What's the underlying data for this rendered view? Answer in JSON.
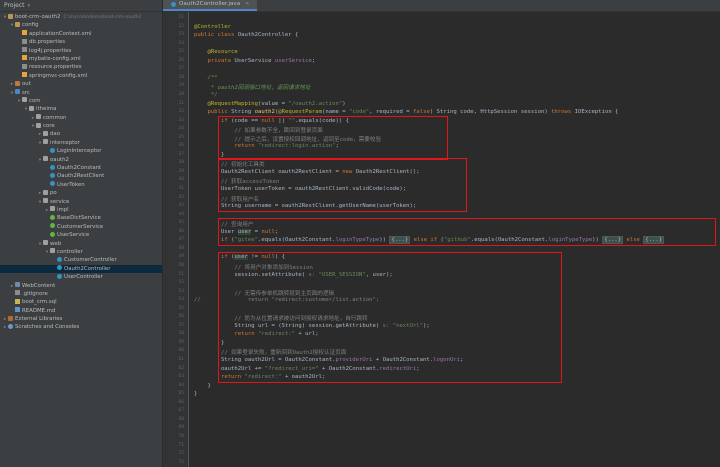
{
  "project_panel": {
    "title": "Project",
    "items": [
      {
        "label": "boot-crm-oauth2",
        "path": "C:\\mycode\\demo\\boot-crm-oauth2",
        "depth": 0,
        "arrow": "▾",
        "icon": "folder"
      },
      {
        "label": "config",
        "depth": 1,
        "arrow": "▾",
        "icon": "folder"
      },
      {
        "label": "applicationContext.xml",
        "depth": 2,
        "arrow": "",
        "icon": "file-xml"
      },
      {
        "label": "db.properties",
        "depth": 2,
        "arrow": "",
        "icon": "file-prop"
      },
      {
        "label": "log4j.properties",
        "depth": 2,
        "arrow": "",
        "icon": "file-prop"
      },
      {
        "label": "mybatis-config.xml",
        "depth": 2,
        "arrow": "",
        "icon": "file-xml"
      },
      {
        "label": "resource.properties",
        "depth": 2,
        "arrow": "",
        "icon": "file-prop"
      },
      {
        "label": "springmvc-config.xml",
        "depth": 2,
        "arrow": "",
        "icon": "file-xml"
      },
      {
        "label": "out",
        "depth": 1,
        "arrow": "▸",
        "icon": "folder-target"
      },
      {
        "label": "src",
        "depth": 1,
        "arrow": "▾",
        "icon": "folder-src"
      },
      {
        "label": "com",
        "depth": 2,
        "arrow": "▾",
        "icon": "pkg"
      },
      {
        "label": "itheima",
        "depth": 3,
        "arrow": "▾",
        "icon": "pkg"
      },
      {
        "label": "common",
        "depth": 4,
        "arrow": "▸",
        "icon": "pkg"
      },
      {
        "label": "core",
        "depth": 4,
        "arrow": "▾",
        "icon": "pkg"
      },
      {
        "label": "dao",
        "depth": 5,
        "arrow": "▸",
        "icon": "pkg"
      },
      {
        "label": "interceptor",
        "depth": 5,
        "arrow": "▾",
        "icon": "pkg"
      },
      {
        "label": "LoginInterceptor",
        "depth": 6,
        "arrow": "",
        "icon": "class"
      },
      {
        "label": "oauth2",
        "depth": 5,
        "arrow": "▾",
        "icon": "pkg"
      },
      {
        "label": "Oauth2Constant",
        "depth": 6,
        "arrow": "",
        "icon": "class"
      },
      {
        "label": "Oauth2RestClient",
        "depth": 6,
        "arrow": "",
        "icon": "class"
      },
      {
        "label": "UserToken",
        "depth": 6,
        "arrow": "",
        "icon": "class"
      },
      {
        "label": "po",
        "depth": 5,
        "arrow": "▸",
        "icon": "pkg"
      },
      {
        "label": "service",
        "depth": 5,
        "arrow": "▾",
        "icon": "pkg"
      },
      {
        "label": "impl",
        "depth": 6,
        "arrow": "▸",
        "icon": "pkg"
      },
      {
        "label": "BaseDictService",
        "depth": 6,
        "arrow": "",
        "icon": "iface"
      },
      {
        "label": "CustomerService",
        "depth": 6,
        "arrow": "",
        "icon": "iface"
      },
      {
        "label": "UserService",
        "depth": 6,
        "arrow": "",
        "icon": "iface"
      },
      {
        "label": "web",
        "depth": 5,
        "arrow": "▾",
        "icon": "pkg"
      },
      {
        "label": "controller",
        "depth": 6,
        "arrow": "▾",
        "icon": "pkg"
      },
      {
        "label": "CustomerController",
        "depth": 7,
        "arrow": "",
        "icon": "class"
      },
      {
        "label": "Oauth2Controller",
        "depth": 7,
        "arrow": "",
        "icon": "class",
        "selected": true
      },
      {
        "label": "UserController",
        "depth": 7,
        "arrow": "",
        "icon": "class"
      },
      {
        "label": "WebContent",
        "depth": 1,
        "arrow": "▸",
        "icon": "folder-blue"
      },
      {
        "label": ".gitignore",
        "depth": 1,
        "arrow": "",
        "icon": "file-prop"
      },
      {
        "label": "boot_crm.sql",
        "depth": 1,
        "arrow": "",
        "icon": "sql"
      },
      {
        "label": "README.md",
        "depth": 1,
        "arrow": "",
        "icon": "md"
      },
      {
        "label": "External Libraries",
        "depth": 0,
        "arrow": "▸",
        "icon": "lib"
      },
      {
        "label": "Scratches and Consoles",
        "depth": 0,
        "arrow": "▸",
        "icon": "scratch"
      }
    ]
  },
  "editor": {
    "tab_label": "Oauth2Controller.java",
    "line_numbers": [
      "21",
      "22",
      "23",
      "24",
      "25",
      "26",
      "27",
      "28",
      "29",
      "30",
      "31",
      "32",
      "33",
      "34",
      "35",
      "36",
      "37",
      "38",
      "39",
      "40",
      "41",
      "42",
      "43",
      "44",
      "45",
      "46",
      "47",
      "48",
      "49",
      "50",
      "51",
      "52",
      "53",
      "54",
      "55",
      "56",
      "57",
      "58",
      "59",
      "60",
      "61",
      "62",
      "63",
      "64",
      "65",
      "66",
      "67",
      "68",
      "69",
      "70",
      "71",
      "72",
      "73"
    ],
    "lines": [
      {
        "tokens": []
      },
      {
        "tokens": [
          {
            "t": "@Controller",
            "c": "an"
          }
        ]
      },
      {
        "tokens": [
          {
            "t": "public class ",
            "c": "kw"
          },
          {
            "t": "Oauth2Controller {"
          }
        ]
      },
      {
        "tokens": []
      },
      {
        "tokens": [
          {
            "t": "    "
          },
          {
            "t": "@Resource",
            "c": "an"
          }
        ]
      },
      {
        "tokens": [
          {
            "t": "    "
          },
          {
            "t": "private ",
            "c": "kw"
          },
          {
            "t": "UserService "
          },
          {
            "t": "userService",
            "c": "fld"
          },
          {
            "t": ";"
          }
        ]
      },
      {
        "tokens": []
      },
      {
        "tokens": [
          {
            "t": "    "
          },
          {
            "t": "/**",
            "c": "doc"
          }
        ]
      },
      {
        "tokens": [
          {
            "t": "     * oauth2回调接口地址，返回请求地址",
            "c": "doc"
          }
        ]
      },
      {
        "tokens": [
          {
            "t": "     */",
            "c": "doc"
          }
        ]
      },
      {
        "tokens": [
          {
            "t": "    "
          },
          {
            "t": "@RequestMapping",
            "c": "an"
          },
          {
            "t": "(value = "
          },
          {
            "t": "\"/oauth2.action\"",
            "c": "str"
          },
          {
            "t": ")"
          }
        ]
      },
      {
        "tokens": [
          {
            "t": "    "
          },
          {
            "t": "public ",
            "c": "kw"
          },
          {
            "t": "String "
          },
          {
            "t": "oauth2",
            "c": "fn"
          },
          {
            "t": "("
          },
          {
            "t": "@RequestParam",
            "c": "an"
          },
          {
            "t": "(name = "
          },
          {
            "t": "\"code\"",
            "c": "str"
          },
          {
            "t": ", required = "
          },
          {
            "t": "false",
            "c": "kw"
          },
          {
            "t": ") String code, HttpSession session) "
          },
          {
            "t": "throws ",
            "c": "kw"
          },
          {
            "t": "IOException {"
          }
        ]
      },
      {
        "tokens": [
          {
            "t": "        "
          },
          {
            "t": "if ",
            "c": "kw"
          },
          {
            "t": "(code == "
          },
          {
            "t": "null ",
            "c": "kw"
          },
          {
            "t": "|| "
          },
          {
            "t": "\"\"",
            "c": "str"
          },
          {
            "t": ".equals(code)) {"
          }
        ]
      },
      {
        "tokens": [
          {
            "t": "            "
          },
          {
            "t": "// 如果参数不全，跳回到登录页面",
            "c": "cm"
          }
        ]
      },
      {
        "tokens": [
          {
            "t": "            "
          },
          {
            "t": "// 提示之后，设置授权回调地址，返回至code，需要校验",
            "c": "cm"
          }
        ]
      },
      {
        "tokens": [
          {
            "t": "            "
          },
          {
            "t": "return ",
            "c": "kw"
          },
          {
            "t": "\"redirect:login.action\"",
            "c": "str"
          },
          {
            "t": ";"
          }
        ]
      },
      {
        "tokens": [
          {
            "t": "        }"
          }
        ]
      },
      {
        "tokens": [
          {
            "t": "        "
          },
          {
            "t": "// 初始化工具类",
            "c": "cm"
          }
        ]
      },
      {
        "tokens": [
          {
            "t": "        Oauth2RestClient oauth2RestClient = "
          },
          {
            "t": "new ",
            "c": "kw"
          },
          {
            "t": "Oauth2RestClient();"
          }
        ]
      },
      {
        "tokens": [
          {
            "t": "        "
          },
          {
            "t": "// 获取accessToken",
            "c": "cm"
          }
        ]
      },
      {
        "tokens": [
          {
            "t": "        UserToken userToken = oauth2RestClient.validCode(code);"
          }
        ]
      },
      {
        "tokens": [
          {
            "t": "        "
          },
          {
            "t": "// 获取用户名",
            "c": "cm"
          }
        ]
      },
      {
        "tokens": [
          {
            "t": "        String username = oauth2RestClient.getUserName(userToken);"
          }
        ]
      },
      {
        "tokens": []
      },
      {
        "tokens": [
          {
            "t": "        "
          },
          {
            "t": "// 查询用户",
            "c": "cm"
          }
        ]
      },
      {
        "tokens": [
          {
            "t": "        User "
          },
          {
            "t": "user",
            "c": "hl"
          },
          {
            "t": " = "
          },
          {
            "t": "null",
            "c": "kw"
          },
          {
            "t": ";"
          }
        ]
      },
      {
        "tokens": [
          {
            "t": "        "
          },
          {
            "t": "if ",
            "c": "kw"
          },
          {
            "t": "("
          },
          {
            "t": "\"gitee\"",
            "c": "str"
          },
          {
            "t": ".equals(Oauth2Constant."
          },
          {
            "t": "loginTypeType",
            "c": "fld"
          },
          {
            "t": ")) "
          },
          {
            "t": "{...}",
            "c": "fold"
          },
          {
            "t": " "
          },
          {
            "t": "else if ",
            "c": "kw"
          },
          {
            "t": "("
          },
          {
            "t": "\"github\"",
            "c": "str"
          },
          {
            "t": ".equals(Oauth2Constant."
          },
          {
            "t": "loginTypeType",
            "c": "fld"
          },
          {
            "t": ")) "
          },
          {
            "t": "{...}",
            "c": "fold"
          },
          {
            "t": " "
          },
          {
            "t": "else ",
            "c": "kw"
          },
          {
            "t": "{...}",
            "c": "fold"
          }
        ]
      },
      {
        "tokens": []
      },
      {
        "tokens": [
          {
            "t": "        "
          },
          {
            "t": "if ",
            "c": "kw"
          },
          {
            "t": "("
          },
          {
            "t": "user",
            "c": "hl"
          },
          {
            "t": " != "
          },
          {
            "t": "null",
            "c": "kw"
          },
          {
            "t": ") {"
          }
        ]
      },
      {
        "tokens": [
          {
            "t": "            "
          },
          {
            "t": "// 将用户对象添加到Session",
            "c": "cm"
          }
        ]
      },
      {
        "tokens": [
          {
            "t": "            session.setAttribute( "
          },
          {
            "t": "s: \"USER_SESSION\"",
            "c": "str"
          },
          {
            "t": ", user);"
          }
        ]
      },
      {
        "tokens": []
      },
      {
        "tokens": [
          {
            "t": "            "
          },
          {
            "t": "// 无需传参单机跳转就到主页面的逻辑",
            "c": "cm"
          }
        ]
      },
      {
        "tokens": [
          {
            "t": "//              return \"redirect:customer/list.action\";",
            "c": "cm"
          }
        ]
      },
      {
        "tokens": []
      },
      {
        "tokens": [
          {
            "t": "            "
          },
          {
            "t": "// 防为从位置请求被访问到授权请求地址，自行跳转",
            "c": "cm"
          }
        ]
      },
      {
        "tokens": [
          {
            "t": "            String url = (String) session.getAttribute( "
          },
          {
            "t": "s: \"nextUrl\"",
            "c": "str"
          },
          {
            "t": ");"
          }
        ]
      },
      {
        "tokens": [
          {
            "t": "            "
          },
          {
            "t": "return ",
            "c": "kw"
          },
          {
            "t": "\"redirect:\"",
            "c": "str"
          },
          {
            "t": " + url;"
          }
        ]
      },
      {
        "tokens": [
          {
            "t": "        }"
          }
        ]
      },
      {
        "tokens": [
          {
            "t": "        "
          },
          {
            "t": "// 如果登录失败，重新回到Oauth2授权认证页面",
            "c": "cm"
          }
        ]
      },
      {
        "tokens": [
          {
            "t": "        String oauth2Url = Oauth2Constant."
          },
          {
            "t": "providerUri",
            "c": "fld"
          },
          {
            "t": " + Oauth2Constant."
          },
          {
            "t": "logonUri",
            "c": "fld"
          },
          {
            "t": ";"
          }
        ]
      },
      {
        "tokens": [
          {
            "t": "        oauth2Url += "
          },
          {
            "t": "\"?redirect_uri=\"",
            "c": "str"
          },
          {
            "t": " + Oauth2Constant."
          },
          {
            "t": "redirectUri",
            "c": "fld"
          },
          {
            "t": ";"
          }
        ]
      },
      {
        "tokens": [
          {
            "t": "        "
          },
          {
            "t": "return ",
            "c": "kw"
          },
          {
            "t": "\"redirect:\"",
            "c": "str"
          },
          {
            "t": " + oauth2Url;"
          }
        ]
      },
      {
        "tokens": [
          {
            "t": "    }"
          }
        ]
      },
      {
        "tokens": [
          {
            "t": "}"
          }
        ]
      },
      {
        "tokens": []
      }
    ]
  }
}
